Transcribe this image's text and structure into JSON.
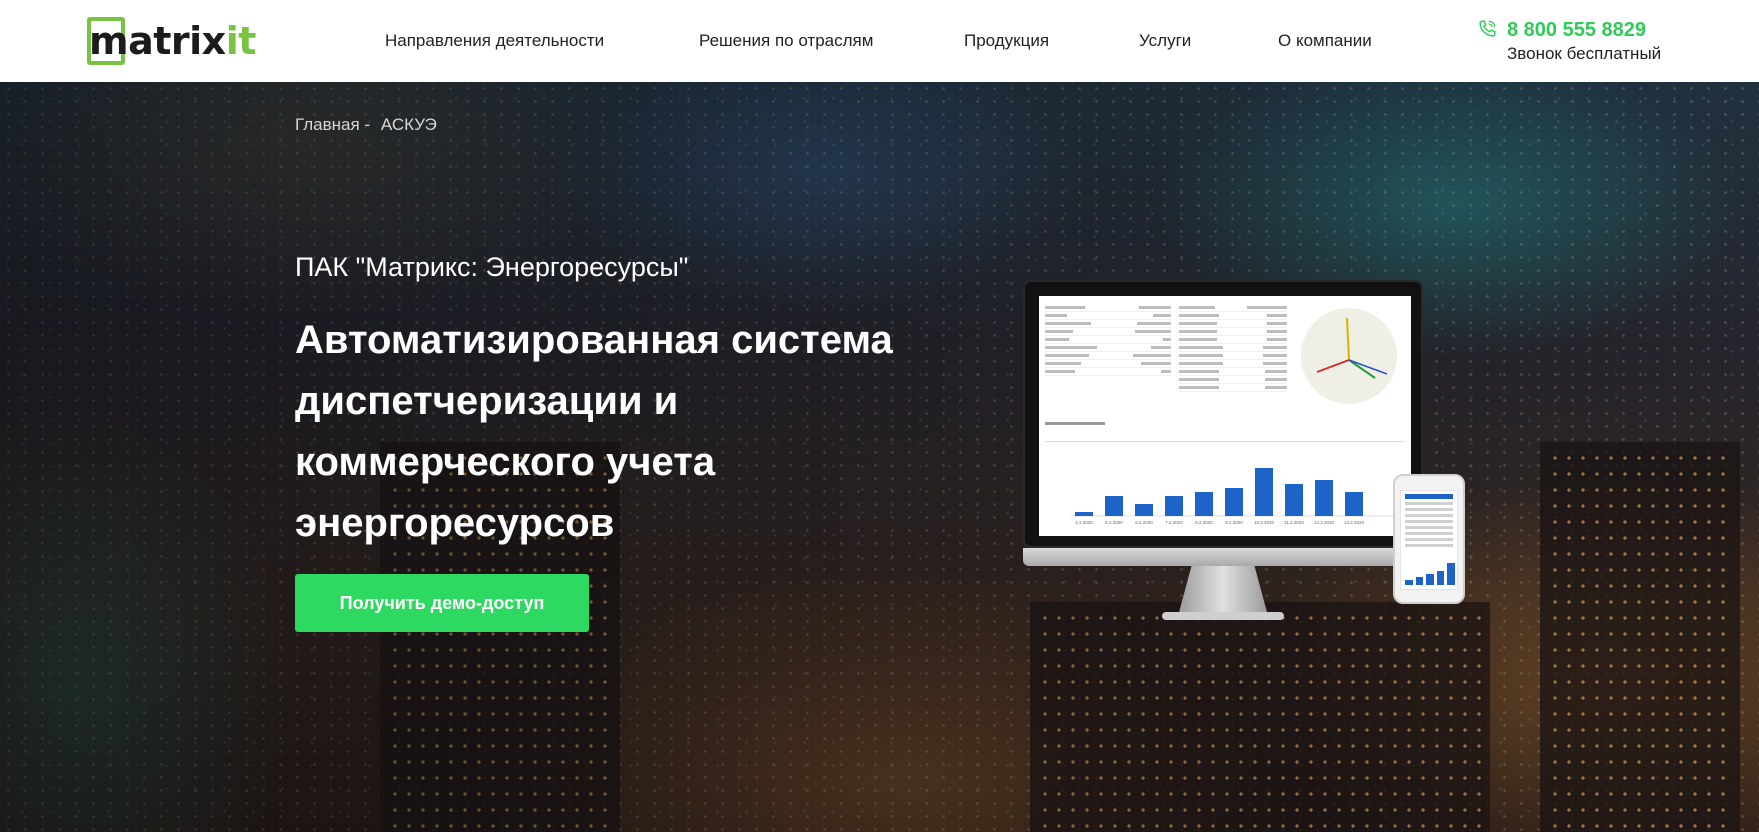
{
  "header": {
    "logo": {
      "box_letter": "m",
      "dark_text": "atrix",
      "green_text": "it"
    },
    "nav": [
      {
        "label": "Направления деятельности"
      },
      {
        "label": "Решения по отраслям"
      },
      {
        "label": "Продукция"
      },
      {
        "label": "Услуги"
      },
      {
        "label": "О компании"
      }
    ],
    "phone": {
      "number": "8 800 555 8829",
      "note": "Звонок бесплатный",
      "icon": "phone-icon"
    }
  },
  "hero": {
    "breadcrumb": {
      "home": "Главная",
      "separator": "-",
      "current": "АСКУЭ"
    },
    "subtitle": "ПАК \"Матрикс: Энергоресурсы\"",
    "title": "Автоматизированная система диспетчеризации и коммерческого учета энергоресурсов",
    "cta_label": "Получить демо-доступ"
  },
  "device_mockup": {
    "bar_values": [
      1,
      5,
      3,
      5,
      6,
      7,
      12,
      8,
      9,
      6
    ],
    "bar_labels": [
      "4.2.2020",
      "5.2.2020",
      "6.2.2020",
      "7.2.2020",
      "8.2.2020",
      "9.2.2020",
      "10.2.2020",
      "11.2.2020",
      "12.2.2020",
      "13.2.2020"
    ],
    "phone_bar_values": [
      2,
      3,
      4,
      5,
      8
    ]
  },
  "colors": {
    "brand_green": "#78c442",
    "phone_green": "#2ecc57",
    "cta_green": "#2ed962",
    "bar_blue": "#1e64c8"
  }
}
